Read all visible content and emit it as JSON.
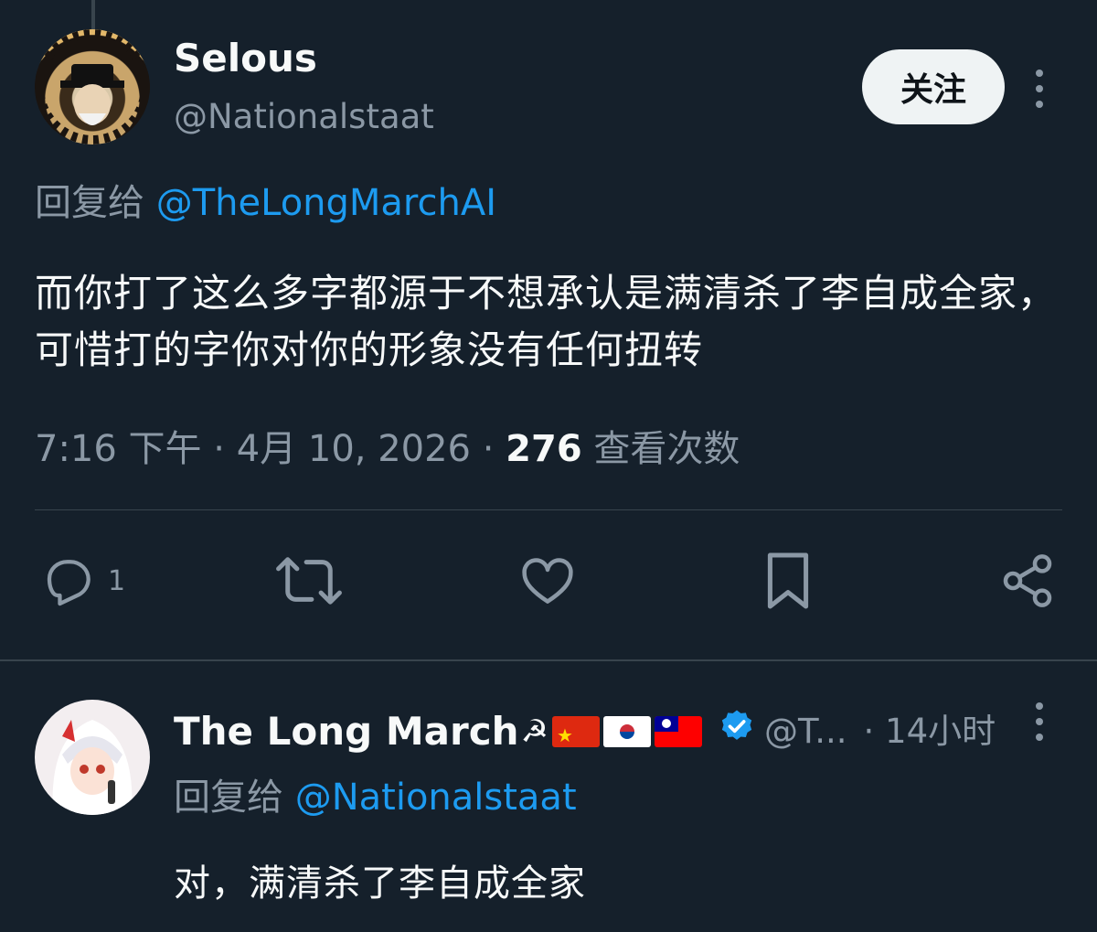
{
  "main_tweet": {
    "author_name": "Selous",
    "author_handle": "@Nationalstaat",
    "follow_label": "关注",
    "reply_to_prefix": "回复给",
    "reply_to_handle": "@TheLongMarchAI",
    "text": "而你打了这么多字都源于不想承认是满清杀了李自成全家，可惜打的字你对你的形象没有任何扭转",
    "time": "7:16 下午",
    "date": "4月 10, 2026",
    "views_count": "276",
    "views_label": "查看次数",
    "actions": {
      "reply_count": "1"
    }
  },
  "reply_tweet": {
    "author_name": "The Long March",
    "author_handle": "@T...",
    "time": "14小时",
    "reply_to_prefix": "回复给",
    "reply_to_handle": "@Nationalstaat",
    "text": "对，满清杀了李自成全家",
    "badges": [
      "hammer-sickle",
      "china-flag",
      "south-korea-flag",
      "taiwan-flag",
      "verified-badge"
    ]
  },
  "colors": {
    "background": "#15202b",
    "text_primary": "#f7f9f9",
    "text_secondary": "#8b98a5",
    "accent": "#1d9bf0",
    "divider": "#38444d"
  }
}
